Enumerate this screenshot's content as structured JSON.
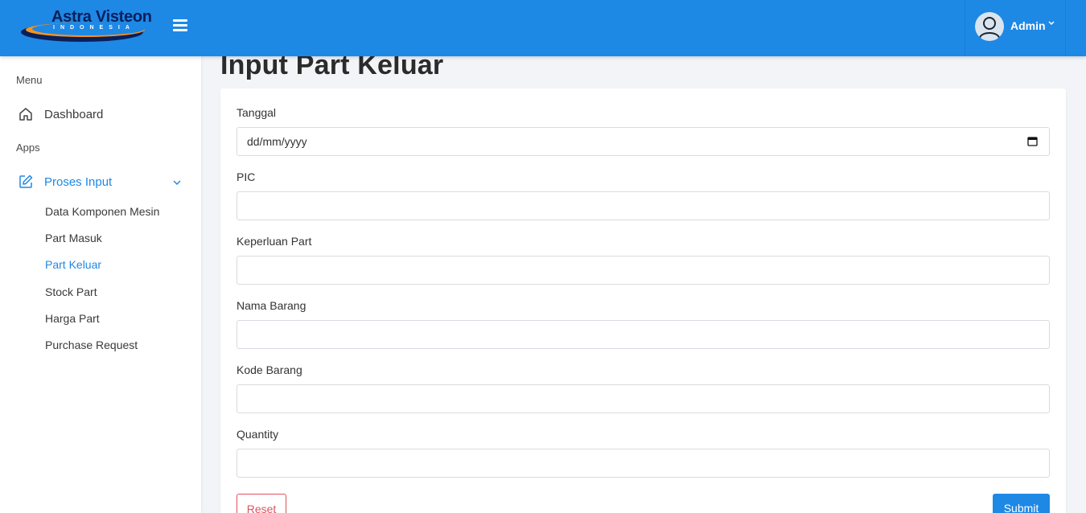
{
  "header": {
    "logo_title": "Astra Visteon",
    "logo_subtitle": "INDONESIA",
    "user_name": "Admin",
    "colors": {
      "primary": "#1e88e5",
      "logo_navy": "#0a1f5c",
      "logo_orange": "#f7941d"
    }
  },
  "sidebar": {
    "menu_heading": "Menu",
    "dashboard_label": "Dashboard",
    "apps_heading": "Apps",
    "proses_input_label": "Proses Input",
    "sub_items": [
      {
        "label": "Data Komponen Mesin"
      },
      {
        "label": "Part Masuk"
      },
      {
        "label": "Part Keluar"
      },
      {
        "label": "Stock Part"
      },
      {
        "label": "Harga Part"
      },
      {
        "label": "Purchase Request"
      }
    ]
  },
  "main": {
    "title": "Input Part Keluar",
    "form": {
      "tanggal_label": "Tanggal",
      "tanggal_placeholder": "dd/mm/yyyy",
      "pic_label": "PIC",
      "keperluan_label": "Keperluan Part",
      "nama_barang_label": "Nama Barang",
      "kode_barang_label": "Kode Barang",
      "quantity_label": "Quantity",
      "reset_label": "Reset",
      "submit_label": "Submit"
    }
  }
}
